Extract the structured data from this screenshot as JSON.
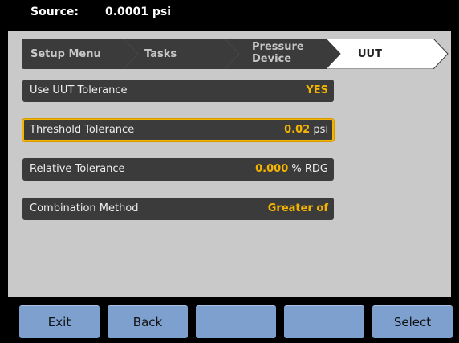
{
  "source": {
    "label": "Source:",
    "value": "0.0001 psi"
  },
  "breadcrumb": [
    {
      "label": "Setup Menu"
    },
    {
      "label": "Tasks"
    },
    {
      "label_line1": "Pressure",
      "label_line2": "Device"
    },
    {
      "label": "UUT"
    }
  ],
  "rows": [
    {
      "label": "Use UUT Tolerance",
      "value": "YES",
      "unit": ""
    },
    {
      "label": "Threshold Tolerance",
      "value": "0.02",
      "unit": "psi"
    },
    {
      "label": "Relative Tolerance",
      "value": "0.000",
      "unit": "% RDG"
    },
    {
      "label": "Combination Method",
      "value": "Greater of",
      "unit": ""
    }
  ],
  "softkeys": [
    {
      "label": "Exit"
    },
    {
      "label": "Back"
    },
    {
      "label": ""
    },
    {
      "label": ""
    },
    {
      "label": "Select"
    }
  ],
  "colors": {
    "accent": "#f4b400",
    "softkey": "#7ea0cf",
    "row": "#3b3b3b",
    "panel": "#c9c9c9"
  }
}
